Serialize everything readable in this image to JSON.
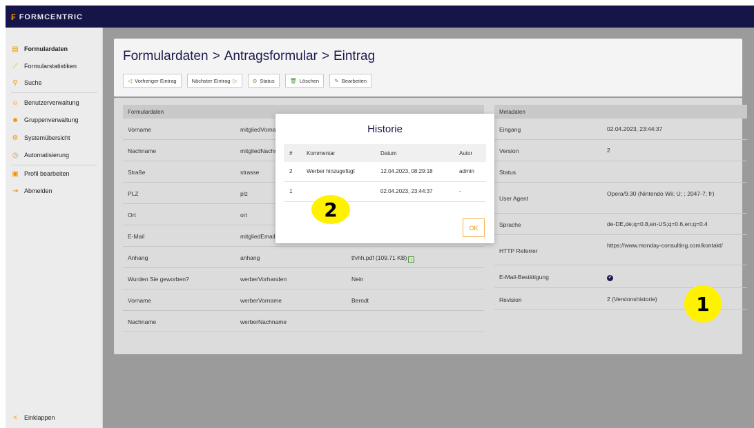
{
  "brand": {
    "name": "FORMCENTRIC",
    "mark": "₣"
  },
  "sidebar": {
    "items": [
      {
        "label": "Formulardaten",
        "icon": "document-icon",
        "glyph": "▤",
        "active": true
      },
      {
        "label": "Formularstatistiken",
        "icon": "chart-line-icon",
        "glyph": "⟋"
      },
      {
        "label": "Suche",
        "icon": "search-icon",
        "glyph": "⚲"
      },
      {
        "label": "Benutzerverwaltung",
        "icon": "user-icon",
        "glyph": "☺"
      },
      {
        "label": "Gruppenverwaltung",
        "icon": "users-icon",
        "glyph": "☻"
      },
      {
        "label": "Systemübersicht",
        "icon": "gear-icon",
        "glyph": "⚙"
      },
      {
        "label": "Automatisierung",
        "icon": "clock-icon",
        "glyph": "◷"
      },
      {
        "label": "Profil bearbeiten",
        "icon": "id-card-icon",
        "glyph": "▣"
      },
      {
        "label": "Abmelden",
        "icon": "logout-icon",
        "glyph": "⇥"
      }
    ],
    "collapse_label": "Einklappen",
    "collapse_glyph": "<"
  },
  "header": {
    "breadcrumb": [
      "Formulardaten",
      "Antragsformular",
      "Eintrag"
    ],
    "separator": ">",
    "toolbar": [
      {
        "label": "Vorheriger Eintrag",
        "glyph": "◁",
        "name": "previous-entry-button",
        "icon": "triangle-left-icon"
      },
      {
        "label": "Nächster Eintrag",
        "glyph": "▷",
        "name": "next-entry-button",
        "icon": "triangle-right-icon"
      },
      {
        "label": "Status",
        "glyph": "⊖",
        "name": "status-button",
        "icon": "status-circle-icon"
      },
      {
        "label": "Löschen",
        "glyph": "🗑",
        "name": "delete-button",
        "icon": "trash-icon"
      },
      {
        "label": "Bearbeiten",
        "glyph": "✎",
        "name": "edit-button",
        "icon": "pencil-icon"
      }
    ]
  },
  "formdata": {
    "header": "Formulardaten",
    "rows": [
      {
        "label": "Vorname",
        "field": "mitgliedVorname",
        "value": ""
      },
      {
        "label": "Nachname",
        "field": "mitgliedNachname",
        "value": ""
      },
      {
        "label": "Straße",
        "field": "strasse",
        "value": ""
      },
      {
        "label": "PLZ",
        "field": "plz",
        "value": ""
      },
      {
        "label": "Ort",
        "field": "ort",
        "value": ""
      },
      {
        "label": "E-Mail",
        "field": "mitgliedEmail",
        "value": ""
      },
      {
        "label": "Anhang",
        "field": "anhang",
        "value": "tfvhh.pdf (109.71 KB)"
      },
      {
        "label": "Wurden Sie geworben?",
        "field": "werberVorhanden",
        "value": "Nein"
      },
      {
        "label": "Vorname",
        "field": "werberVorname",
        "value": "Berndt"
      },
      {
        "label": "Nachname",
        "field": "werberNachname",
        "value": ""
      }
    ]
  },
  "metadata": {
    "header": "Metadaten",
    "rows": [
      {
        "label": "Eingang",
        "value": "02.04.2023, 23:44:37"
      },
      {
        "label": "Version",
        "value": "2"
      },
      {
        "label": "Status",
        "value": ""
      },
      {
        "label": "User Agent",
        "value": "Opera/9.30 (Nintendo Wii; U; ; 2047-7; fr)"
      },
      {
        "label": "Sprache",
        "value": "de-DE,de;q=0.8,en-US;q=0.6,en;q=0.4"
      },
      {
        "label": "HTTP Referrer",
        "value": "https://www.monday-consulting.com/kontakt/"
      },
      {
        "label": "E-Mail-Bestätigung",
        "value": "✔"
      },
      {
        "label": "Revision",
        "value": "2 (Versionshistorie)"
      }
    ]
  },
  "modal": {
    "title": "Historie",
    "columns": [
      "#",
      "Kommentar",
      "Datum",
      "Autor"
    ],
    "rows": [
      {
        "n": "2",
        "comment": "Werber hinzugefügt",
        "date": "12.04.2023, 08:29:18",
        "author": "admin"
      },
      {
        "n": "1",
        "comment": "",
        "date": "02.04.2023, 23:44:37",
        "author": "-"
      }
    ],
    "ok_label": "OK"
  },
  "annotations": {
    "marker_1": "1",
    "marker_2": "2"
  },
  "colors": {
    "topbar": "#16154a",
    "accent": "#f29100",
    "title": "#1b1a4f",
    "green": "#4a9a2f",
    "highlight": "#fff200"
  }
}
